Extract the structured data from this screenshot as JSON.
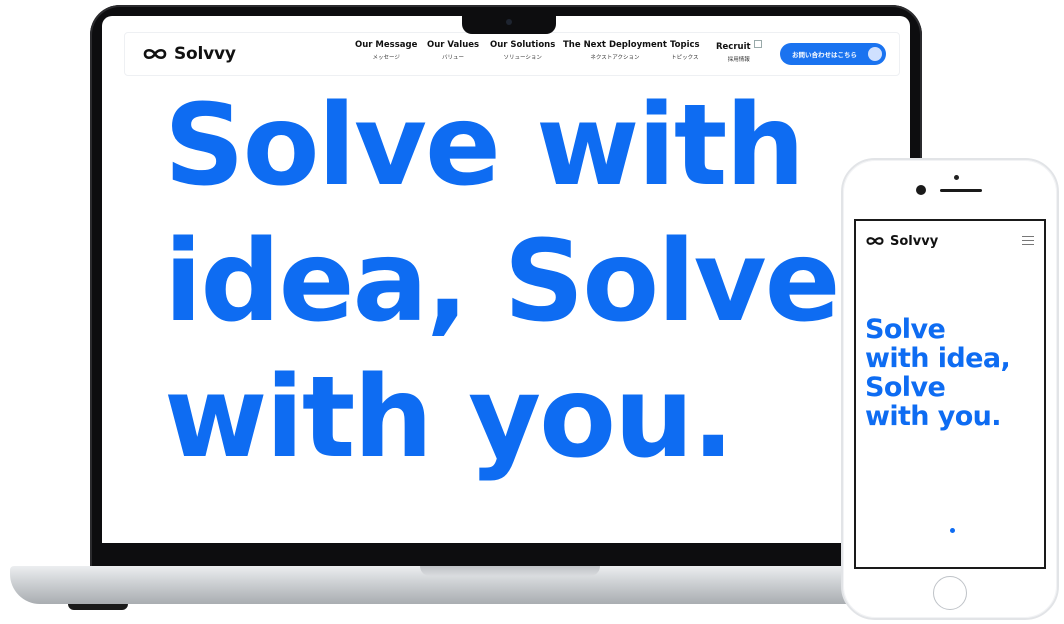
{
  "brand": {
    "name": "Solvvy",
    "accent_color": "#0e6cf2",
    "button_color": "#1a73f0"
  },
  "desktop": {
    "nav": {
      "items": [
        {
          "en": "Our Message",
          "jp": "メッセージ"
        },
        {
          "en": "Our Values",
          "jp": "バリュー"
        },
        {
          "en": "Our Solutions",
          "jp": "ソリューション"
        },
        {
          "en": "The Next Deployment",
          "jp": "ネクストアクション"
        },
        {
          "en": "Topics",
          "jp": "トピックス"
        },
        {
          "en": "Recruit",
          "jp": "採用情報"
        }
      ],
      "cta_label": "お問い合わせはこちら"
    },
    "hero": {
      "line1": "Solve with",
      "line2": "idea, Solve",
      "line3": "with you."
    }
  },
  "mobile": {
    "hero": {
      "line1": "Solve",
      "line2": "with idea,",
      "line3": "Solve",
      "line4": "with you."
    }
  },
  "icons": [
    "logo-infinity-icon",
    "external-link-icon",
    "arrow-circle-icon",
    "hamburger-menu-icon"
  ]
}
